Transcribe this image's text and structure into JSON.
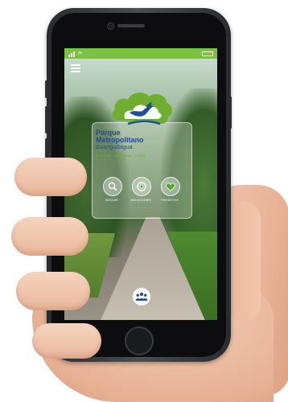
{
  "app": {
    "brand_line1": "Parque",
    "brand_line2": "Metropolitano",
    "brand_line3": "Guanguiltagua",
    "brand_tagline": "CONOCE · DISFRUTA · CUIDA"
  },
  "actions": [
    {
      "label": "BUSCAR",
      "icon": "search-icon"
    },
    {
      "label": "UBICACIONES",
      "icon": "location-target-icon"
    },
    {
      "label": "FAVORITOS",
      "icon": "heart-icon"
    }
  ],
  "colors": {
    "status_bar": "#7cc241",
    "brand_blue": "#1d4e96",
    "brand_green": "#6fae2f",
    "accent_green": "#5aa72e"
  },
  "icons": {
    "menu": "hamburger-menu-icon",
    "group": "people-group-icon",
    "logo": "park-cloud-bird-logo"
  }
}
